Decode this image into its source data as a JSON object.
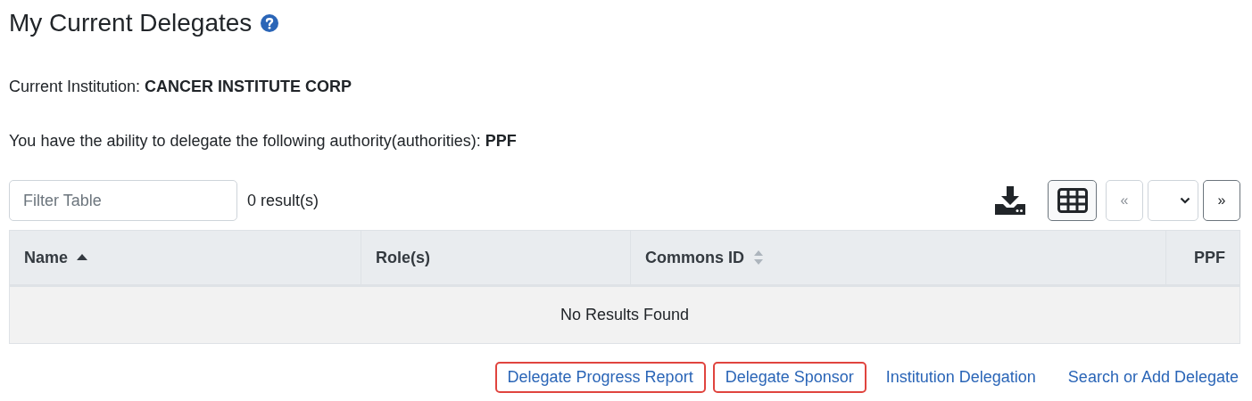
{
  "page": {
    "title": "My Current Delegates"
  },
  "institution": {
    "label": "Current Institution:",
    "value": "CANCER INSTITUTE CORP"
  },
  "authority": {
    "label": "You have the ability to delegate the following authority(authorities):",
    "value": "PPF"
  },
  "toolbar": {
    "filter_placeholder": "Filter Table",
    "result_count": "0 result(s)",
    "prev": {
      "label": "«",
      "disabled": true
    },
    "next": {
      "label": "»",
      "disabled": false
    }
  },
  "table": {
    "columns": [
      {
        "label": "Name",
        "kind": "sorted"
      },
      {
        "label": "Role(s)",
        "kind": "plain"
      },
      {
        "label": "Commons ID",
        "kind": "sortable"
      },
      {
        "label": "PPF",
        "kind": "flag"
      }
    ],
    "empty_message": "No Results Found"
  },
  "links": [
    {
      "label": "Delegate Progress Report",
      "highlighted": true
    },
    {
      "label": "Delegate Sponsor",
      "highlighted": true
    },
    {
      "label": "Institution Delegation",
      "highlighted": false
    },
    {
      "label": "Search or Add Delegate",
      "highlighted": false
    }
  ]
}
